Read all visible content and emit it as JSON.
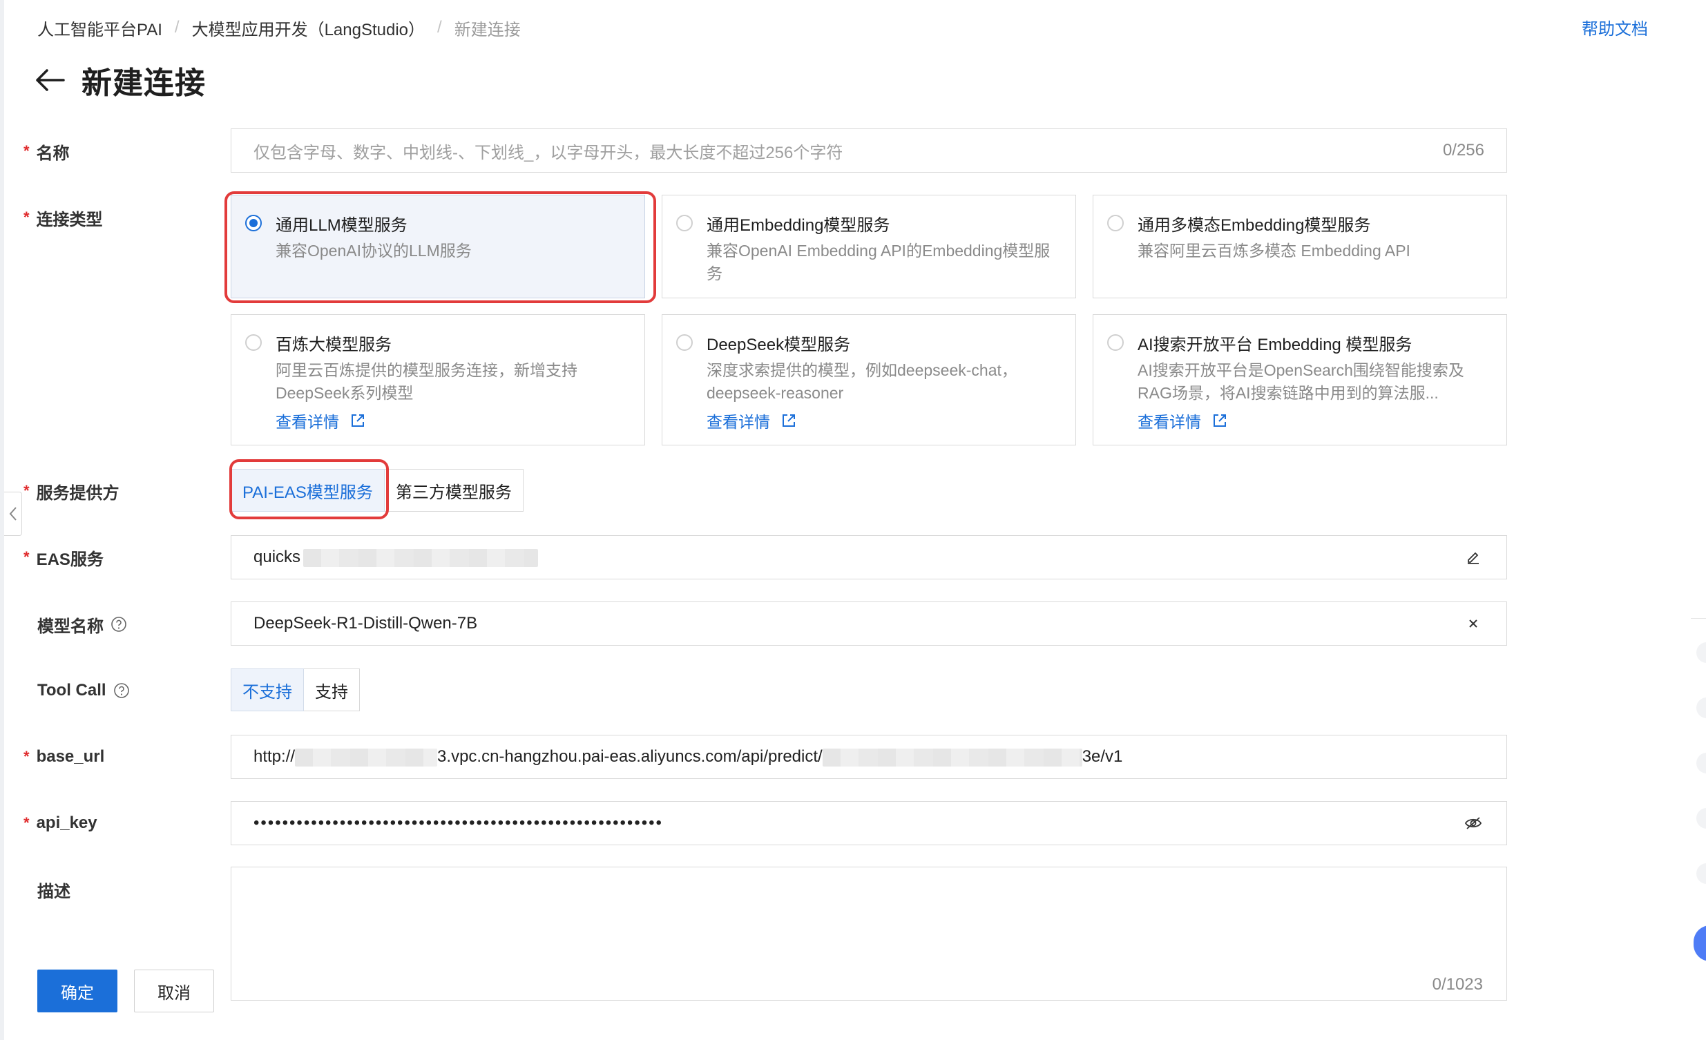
{
  "breadcrumb": {
    "items": [
      "人工智能平台PAI",
      "大模型应用开发（LangStudio）"
    ],
    "current": "新建连接"
  },
  "help": {
    "label": "帮助文档"
  },
  "page": {
    "title": "新建连接"
  },
  "form": {
    "name": {
      "label": "名称",
      "placeholder": "仅包含字母、数字、中划线-、下划线_，以字母开头，最大长度不超过256个字符",
      "counter": "0/256"
    },
    "connection_type": {
      "label": "连接类型",
      "options": [
        {
          "title": "通用LLM模型服务",
          "desc": "兼容OpenAI协议的LLM服务",
          "selected": true
        },
        {
          "title": "通用Embedding模型服务",
          "desc": "兼容OpenAI Embedding API的Embedding模型服务",
          "selected": false
        },
        {
          "title": "通用多模态Embedding模型服务",
          "desc": "兼容阿里云百炼多模态 Embedding API",
          "selected": false
        },
        {
          "title": "百炼大模型服务",
          "desc": "阿里云百炼提供的模型服务连接，新增支持DeepSeek系列模型",
          "link": "查看详情",
          "selected": false
        },
        {
          "title": "DeepSeek模型服务",
          "desc": "深度求索提供的模型，例如deepseek-chat，deepseek-reasoner",
          "link": "查看详情",
          "selected": false
        },
        {
          "title": "AI搜索开放平台 Embedding 模型服务",
          "desc": "AI搜索开放平台是OpenSearch围绕智能搜索及RAG场景，将AI搜索链路中用到的算法服...",
          "link": "查看详情",
          "selected": false
        }
      ]
    },
    "provider": {
      "label": "服务提供方",
      "options": [
        "PAI-EAS模型服务",
        "第三方模型服务"
      ],
      "selected": "PAI-EAS模型服务"
    },
    "eas_service": {
      "label": "EAS服务",
      "value": "quicks"
    },
    "model_name": {
      "label": "模型名称",
      "value": "DeepSeek-R1-Distill-Qwen-7B"
    },
    "tool_call": {
      "label": "Tool Call",
      "options": [
        "不支持",
        "支持"
      ],
      "selected": "不支持"
    },
    "base_url": {
      "label": "base_url",
      "prefix": "http://",
      "middle": "3.vpc.cn-hangzhou.pai-eas.aliyuncs.com/api/predict/",
      "suffix": "3e/v1"
    },
    "api_key": {
      "label": "api_key",
      "masked": "•••••••••••••••••••••••••••••••••••••••••••••••••••••••••"
    },
    "description": {
      "label": "描述",
      "counter": "0/1023"
    }
  },
  "actions": {
    "confirm": "确定",
    "cancel": "取消"
  },
  "colors": {
    "primary": "#1b6fd9",
    "required": "#e0292b",
    "highlight": "#e23b3b"
  },
  "icons": {
    "back": "arrow-left-icon",
    "question": "question-circle-icon",
    "external": "external-link-icon",
    "edit": "pencil-icon",
    "clear": "close-icon",
    "visibility": "eye-off-icon",
    "collapse": "chevron-left-icon"
  }
}
